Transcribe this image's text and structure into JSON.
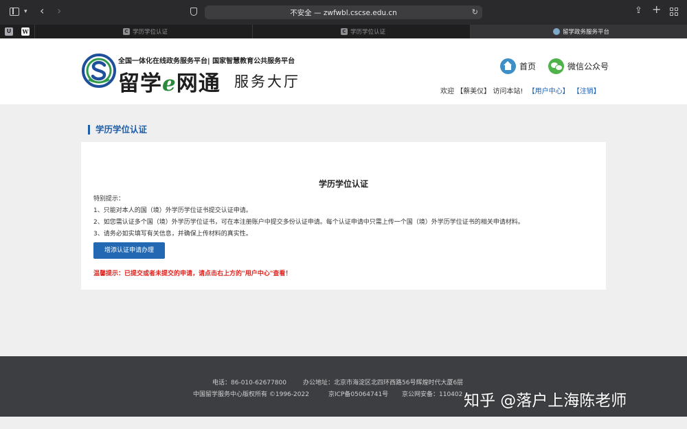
{
  "browser": {
    "address": "不安全 — zwfwbl.cscse.edu.cn",
    "pinned": [
      "U",
      "W"
    ],
    "tabs": [
      {
        "title": "学历学位认证",
        "favicon": "C"
      },
      {
        "title": "学历学位认证",
        "favicon": "C"
      },
      {
        "title": "留学政务服务平台",
        "favicon": "globe"
      }
    ]
  },
  "header": {
    "slogan": "全国一体化在线政务服务平台| 国家智慧教育公共服务平台",
    "brand_a": "留学",
    "brand_e": "e",
    "brand_b": "网通",
    "brand_sub": "服务大厅",
    "nav_home": "首页",
    "nav_wechat": "微信公众号",
    "welcome_prefix": "欢迎",
    "user_name": "【蔡美仪】",
    "welcome_suffix": "访问本站!",
    "user_center": "【用户中心】",
    "logout": "【注销】"
  },
  "main": {
    "section_title": "学历学位认证",
    "card_title": "学历学位认证",
    "tips": [
      "特别提示：",
      "1、只能对本人的国（境）外学历学位证书提交认证申请。",
      "2、如您需认证多个国（境）外学历学位证书，可在本注册账户中提交多份认证申请。每个认证申请中只需上传一个国（境）外学历学位证书的相关申请材料。",
      "3、请务必如实填写有关信息，并确保上传材料的真实性。"
    ],
    "apply_button": "增添认证申请办理",
    "warm_tip": "温馨提示：已提交或者未提交的申请，请点击右上方的\"用户中心\"查看！"
  },
  "footer": {
    "phone": "电话：86-010-62677800",
    "address": "办公地址：北京市海淀区北四环西路56号辉煌时代大厦6层",
    "copyright": "中国留学服务中心版权所有 ©1996-2022",
    "icp": "京ICP备05064741号",
    "police": "京公网安备：110402"
  },
  "watermark": "知乎 @落户上海陈老师",
  "colors": {
    "accent": "#2268b2",
    "warning": "#e0241f",
    "footer_bg": "#3d3e41"
  }
}
